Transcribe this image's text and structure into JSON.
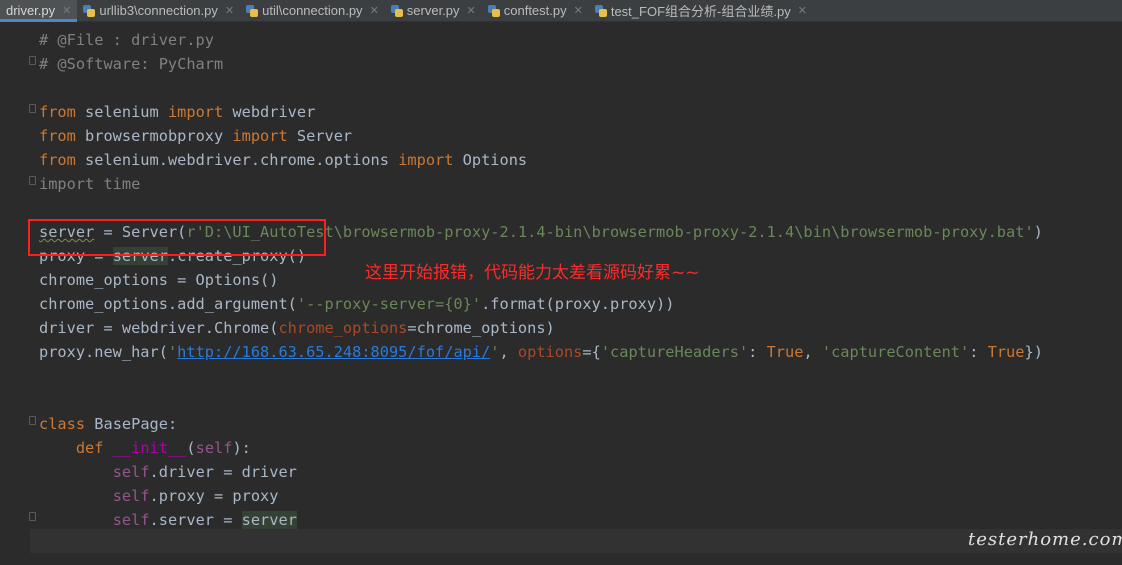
{
  "tabs": [
    {
      "label": "driver.py",
      "active": true
    },
    {
      "label": "urllib3\\connection.py",
      "active": false
    },
    {
      "label": "util\\connection.py",
      "active": false
    },
    {
      "label": "server.py",
      "active": false
    },
    {
      "label": "conftest.py",
      "active": false
    },
    {
      "label": "test_FOF组合分析-组合业绩.py",
      "active": false
    }
  ],
  "code": {
    "file_comment": "# @File : driver.py",
    "software_comment": "# @Software: PyCharm",
    "server_path": "r'D:\\UI_AutoTest\\browsermob-proxy-2.1.4-bin\\browsermob-proxy-2.1.4\\bin\\browsermob-proxy.bat'",
    "proxy_arg": "'--proxy-server={0}'",
    "har_url": "http://168.63.65.248:8095/fof/api/",
    "capture_headers_key": "'captureHeaders'",
    "capture_content_key": "'captureContent'"
  },
  "annotation": "这里开始报错，代码能力太差看源码好累~~",
  "watermark": "testerhome.com",
  "colors": {
    "editor_bg": "#2b2b2b",
    "keyword": "#cc7832",
    "string": "#6a8759",
    "comment": "#808080",
    "annotation_red": "#ff2a2a"
  }
}
